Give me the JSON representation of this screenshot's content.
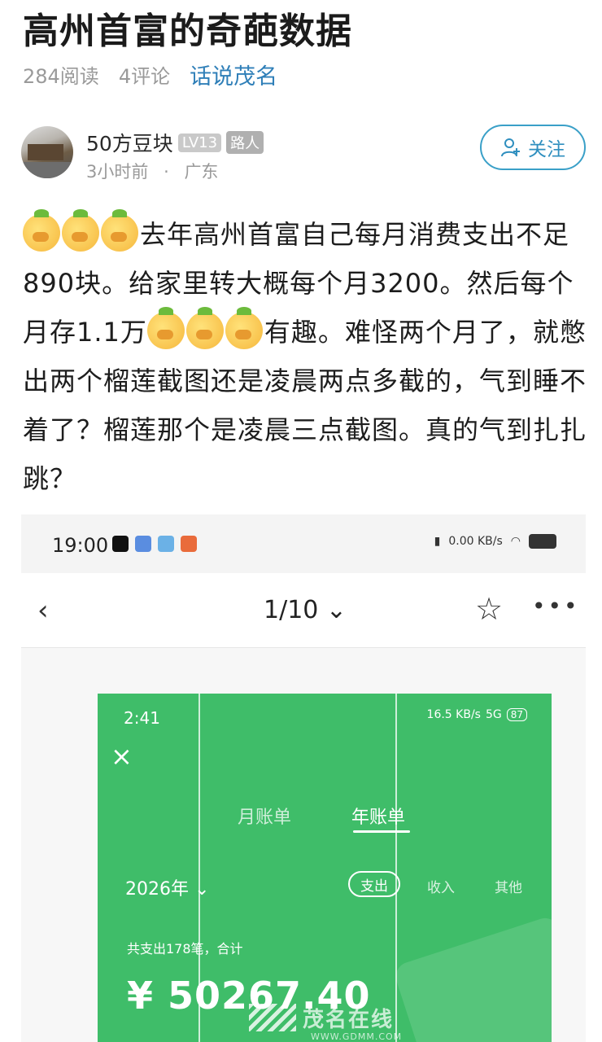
{
  "article": {
    "title": "高州首富的奇葩数据",
    "reads": "284阅读",
    "comments": "4评论",
    "topic": "话说茂名"
  },
  "author": {
    "name": "50方豆块",
    "level": "LV13",
    "role": "路人",
    "time": "3小时前",
    "separator": "·",
    "location": "广东",
    "follow_label": "关注"
  },
  "post": {
    "seg1": "去年高州首富自己每月消费支出不足890块。给家里转大概每个月3200。然后每个月存1.1万",
    "seg2": "有趣。难怪两个月了，就憋出两个榴莲截图还是凌晨两点多截的，气到睡不着了？榴莲那个是凌晨三点截图。真的气到扎扎跳？"
  },
  "screenshot": {
    "status_time": "19:00",
    "net_speed": "0.00 KB/s",
    "pager": "1/10",
    "pager_caret": "⌄",
    "inner": {
      "time": "2:41",
      "net": "16.5 KB/s",
      "signal": "5G",
      "battery": "87",
      "close": "×",
      "tab_month": "月账单",
      "tab_year": "年账单",
      "year": "2026年 ⌄",
      "filter_expense": "支出",
      "filter_income": "收入",
      "filter_other": "其他",
      "count_text": "共支出178笔，合计",
      "amount": "¥ 50267.40"
    },
    "watermark": "茂名在线",
    "watermark_url": "WWW.GDMM.COM"
  }
}
